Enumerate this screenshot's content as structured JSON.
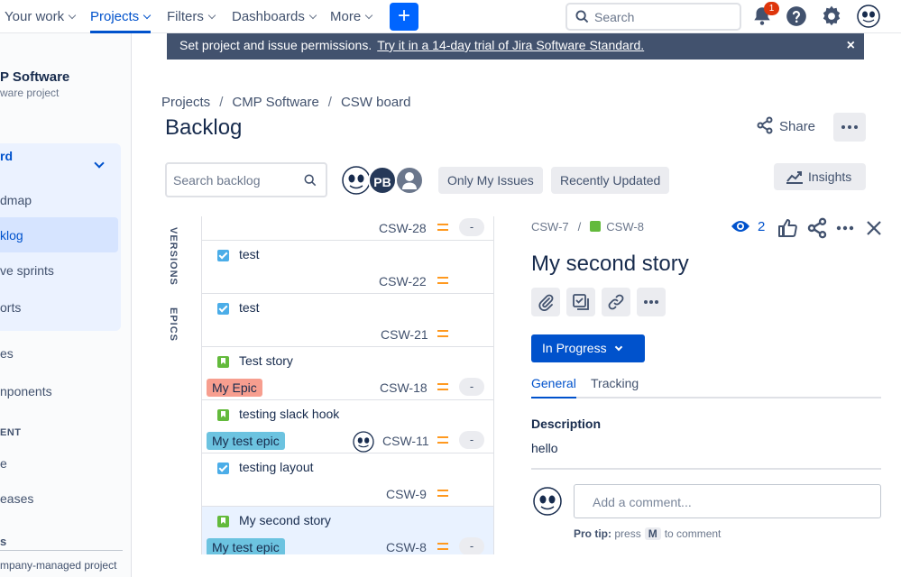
{
  "nav": {
    "your_work": "Your work",
    "projects": "Projects",
    "filters": "Filters",
    "dashboards": "Dashboards",
    "more": "More",
    "create": "+",
    "search_placeholder": "Search",
    "notification_count": "1"
  },
  "banner": {
    "text": "Set project and issue permissions.",
    "link": "Try it in a 14-day trial of Jira Software Standard.",
    "close": "×"
  },
  "sidebar": {
    "project_name": "P Software",
    "project_type": "ware project",
    "group_title": "rd",
    "items": [
      {
        "label": "dmap"
      },
      {
        "label": "klog"
      },
      {
        "label": "ve sprints"
      },
      {
        "label": "orts"
      },
      {
        "label": "es"
      },
      {
        "label": "nponents"
      }
    ],
    "section_heading": "ENT",
    "items2": [
      {
        "label": "e"
      },
      {
        "label": "eases"
      }
    ],
    "section2_heading": "s",
    "footer": "mpany-managed project"
  },
  "breadcrumb": [
    "Projects",
    "CMP Software",
    "CSW board"
  ],
  "page_title": "Backlog",
  "share_label": "Share",
  "backlog_search_placeholder": "Search backlog",
  "avatar_initials": "PB",
  "filters": {
    "only_my_issues": "Only My Issues",
    "recently_updated": "Recently Updated"
  },
  "insights_label": "Insights",
  "side_labels": {
    "versions": "VERSIONS",
    "epics": "EPICS"
  },
  "issues": [
    {
      "summary": "",
      "key": "CSW-28",
      "type": "none",
      "epic": "",
      "estimate": "-",
      "assignee": false
    },
    {
      "summary": "test",
      "key": "CSW-22",
      "type": "task",
      "epic": "",
      "estimate": "",
      "assignee": false
    },
    {
      "summary": "test",
      "key": "CSW-21",
      "type": "task",
      "epic": "",
      "estimate": "",
      "assignee": false
    },
    {
      "summary": "Test story",
      "key": "CSW-18",
      "type": "story",
      "epic": "My Epic",
      "epic_color": "#f79e8f",
      "estimate": "-",
      "assignee": false
    },
    {
      "summary": "testing slack hook",
      "key": "CSW-11",
      "type": "story",
      "epic": "My test epic",
      "epic_color": "#6cc3e0",
      "estimate": "-",
      "assignee": true
    },
    {
      "summary": "testing layout",
      "key": "CSW-9",
      "type": "task",
      "epic": "",
      "estimate": "",
      "assignee": false
    },
    {
      "summary": "My second story",
      "key": "CSW-8",
      "type": "story",
      "epic": "My test epic",
      "epic_color": "#6cc3e0",
      "estimate": "-",
      "assignee": false,
      "selected": true
    }
  ],
  "detail": {
    "parent_key": "CSW-7",
    "key": "CSW-8",
    "watch_count": "2",
    "title": "My second story",
    "status": "In Progress",
    "tabs": [
      "General",
      "Tracking"
    ],
    "description_label": "Description",
    "description": "hello",
    "comment_placeholder": "Add a comment...",
    "pro_tip_label": "Pro tip:",
    "pro_tip_press": "press",
    "pro_tip_key": "M",
    "pro_tip_suffix": "to comment"
  },
  "colors": {
    "accent": "#0052cc",
    "create_button": "#0065ff",
    "banner_bg": "#42526e",
    "story": "#63ba3c",
    "task": "#4bade8",
    "priority_medium": "#ff991f"
  }
}
